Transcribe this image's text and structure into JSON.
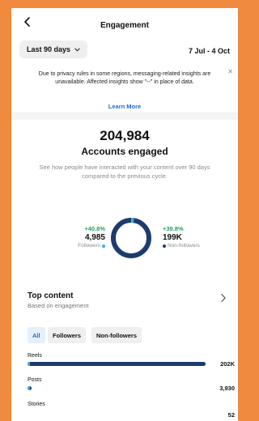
{
  "header": {
    "title": "Engagement",
    "back_icon": "chevron-left-icon"
  },
  "range": {
    "selected": "Last 90 days",
    "dropdown_icon": "chevron-down-icon",
    "dates": "7 Jul - 4 Oct"
  },
  "notice": {
    "text": "Due to privacy rules in some regions, messaging-related insights are unavailable. Affected insights show \"--\" in place of data.",
    "link": "Learn More",
    "close_icon": "close-icon"
  },
  "summary": {
    "value": "204,984",
    "label": "Accounts engaged",
    "description": "See how people have interacted with your content over 90 days compared to the previous cycle."
  },
  "breakdown": {
    "followers": {
      "change": "+40.8%",
      "value": "4,985",
      "label": "Followers",
      "color": "#46a9e2",
      "share": 0.024
    },
    "non_followers": {
      "change": "+39.8%",
      "value": "199K",
      "label": "Non-followers",
      "color": "#1c3c6e",
      "share": 0.976
    }
  },
  "top_content": {
    "title": "Top content",
    "subtitle": "Based on engagement",
    "chevron_icon": "chevron-right-icon"
  },
  "filters": [
    {
      "label": "All",
      "active": true
    },
    {
      "label": "Followers",
      "active": false
    },
    {
      "label": "Non-followers",
      "active": false
    }
  ],
  "metrics": [
    {
      "label": "Reels",
      "value": "202K",
      "fraction": 1.0
    },
    {
      "label": "Posts",
      "value": "3,930",
      "fraction": 0.02
    },
    {
      "label": "Stories",
      "value": "52",
      "fraction": 0.0
    }
  ],
  "colors": {
    "accent": "#1f6ec8",
    "positive": "#25a05a",
    "bar_dark": "#1c3c6e",
    "bar_light": "#46a9e2",
    "background": "#ef8a3f"
  }
}
